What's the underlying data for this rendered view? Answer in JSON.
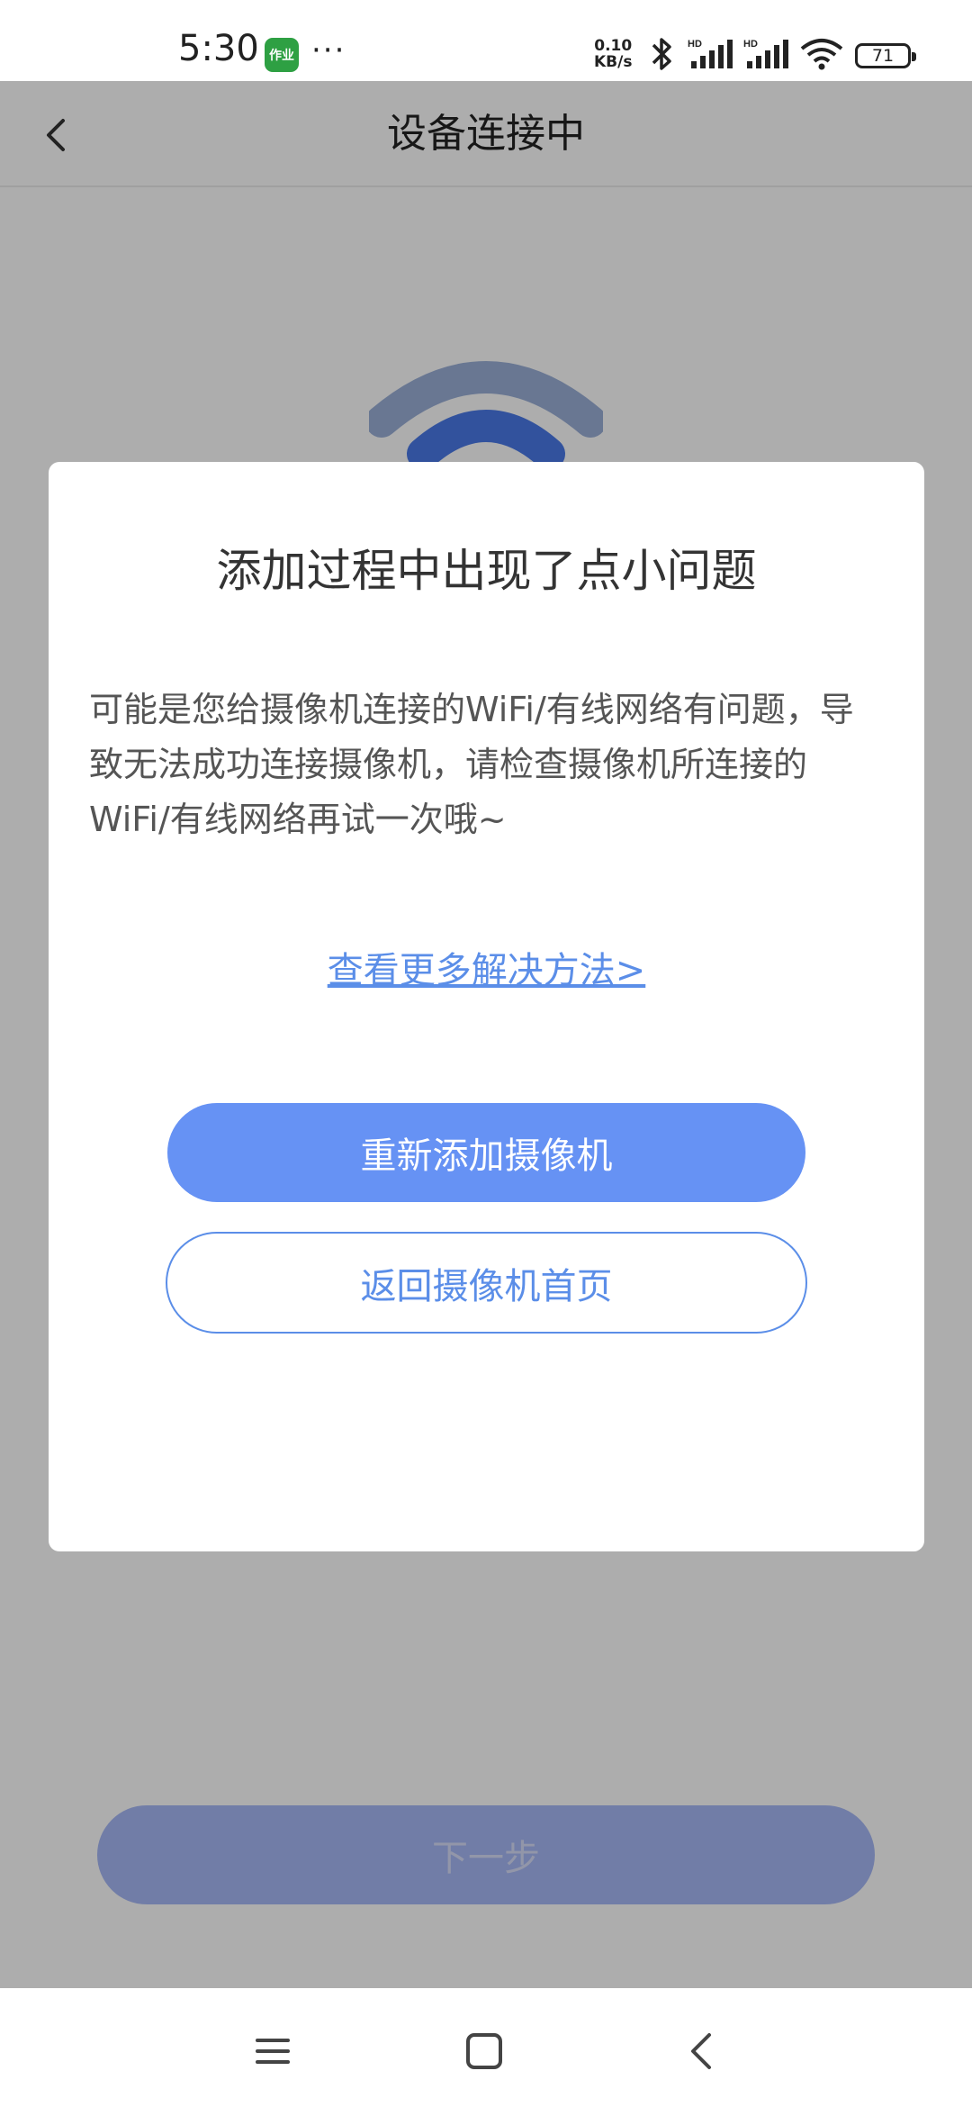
{
  "status_bar": {
    "time": "5:30",
    "app_icon_text": "作业",
    "more": "···",
    "net_speed_value": "0.10",
    "net_speed_unit": "KB/s",
    "battery": "71"
  },
  "header": {
    "title": "设备连接中"
  },
  "background": {
    "next_button": "下一步"
  },
  "dialog": {
    "title": "添加过程中出现了点小问题",
    "body": "可能是您给摄像机连接的WiFi/有线网络有问题，导致无法成功连接摄像机，请检查摄像机所连接的WiFi/有线网络再试一次哦~",
    "link": "查看更多解决方法>",
    "primary_button": "重新添加摄像机",
    "secondary_button": "返回摄像机首页"
  },
  "colors": {
    "accent": "#6692f4",
    "link": "#5b8ee8"
  },
  "icons": {
    "back": "chevron-left-icon",
    "bluetooth": "bluetooth-icon",
    "signal": "cell-signal-icon",
    "wifi": "wifi-icon",
    "battery": "battery-icon",
    "nav_menu": "menu-icon",
    "nav_home": "home-square-icon",
    "nav_back": "back-chevron-icon"
  }
}
